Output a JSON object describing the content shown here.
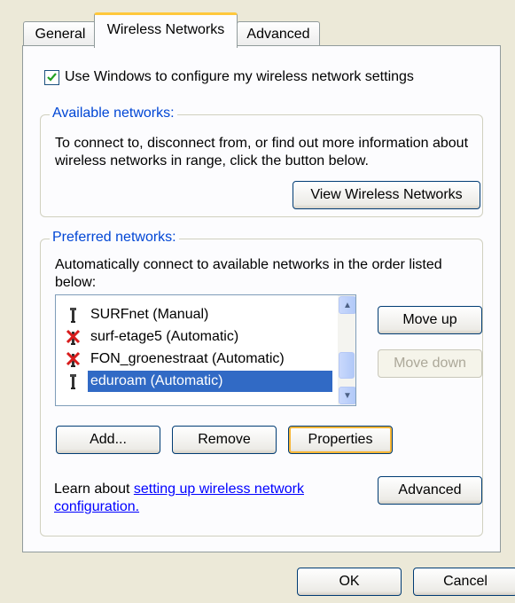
{
  "tabs": [
    {
      "label": "General"
    },
    {
      "label": "Wireless Networks"
    },
    {
      "label": "Advanced"
    }
  ],
  "use_windows": {
    "label": "Use Windows to configure my wireless network settings",
    "checked": true
  },
  "available": {
    "legend": "Available networks:",
    "description": "To connect to, disconnect from, or find out more information about wireless networks in range, click the button below.",
    "view_button": "View Wireless Networks"
  },
  "preferred": {
    "legend": "Preferred networks:",
    "description": "Automatically connect to available networks in the order listed below:",
    "networks": [
      {
        "name": "SURFnet (Manual)",
        "icon": "antenna-icon"
      },
      {
        "name": "surf-etage5 (Automatic)",
        "icon": "antenna-unavailable-icon"
      },
      {
        "name": "FON_groenestraat (Automatic)",
        "icon": "antenna-unavailable-icon"
      },
      {
        "name": "eduroam (Automatic)",
        "icon": "antenna-icon",
        "selected": true
      }
    ],
    "move_up": "Move up",
    "move_down": "Move down",
    "add": "Add...",
    "remove": "Remove",
    "properties": "Properties",
    "learn_prefix": "Learn about ",
    "learn_link": "setting up wireless network configuration.",
    "advanced": "Advanced"
  },
  "footer": {
    "ok": "OK",
    "cancel": "Cancel"
  }
}
